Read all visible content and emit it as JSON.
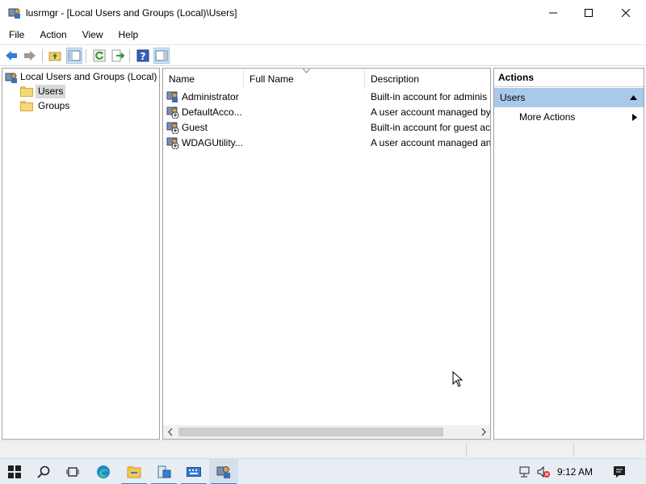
{
  "window": {
    "title": "lusrmgr - [Local Users and Groups (Local)\\Users]"
  },
  "menu": [
    "File",
    "Action",
    "View",
    "Help"
  ],
  "toolbar": {
    "buttons": [
      "back-icon",
      "forward-icon",
      "up-folder-icon",
      "show-hide-tree-icon",
      "refresh-icon",
      "export-list-icon",
      "help-icon",
      "show-hide-action-pane-icon"
    ]
  },
  "tree": {
    "root": "Local Users and Groups (Local)",
    "children": [
      "Users",
      "Groups"
    ],
    "selected": "Users"
  },
  "list": {
    "columns": [
      "Name",
      "Full Name",
      "Description"
    ],
    "rows": [
      {
        "name": "Administrator",
        "full_name": "",
        "description": "Built-in account for adminis"
      },
      {
        "name": "DefaultAcco...",
        "full_name": "",
        "description": "A user account managed by"
      },
      {
        "name": "Guest",
        "full_name": "",
        "description": "Built-in account for guest ac"
      },
      {
        "name": "WDAGUtility...",
        "full_name": "",
        "description": "A user account managed an"
      }
    ]
  },
  "actions": {
    "title": "Actions",
    "section": "Users",
    "items": [
      "More Actions"
    ]
  },
  "taskbar": {
    "clock": "9:12 AM",
    "accent": "#3b7fd1"
  },
  "colors": {
    "selection": "#d9d9d9",
    "action_header": "#a9c9ea",
    "toolbar_pressed": "#cde6f7"
  }
}
